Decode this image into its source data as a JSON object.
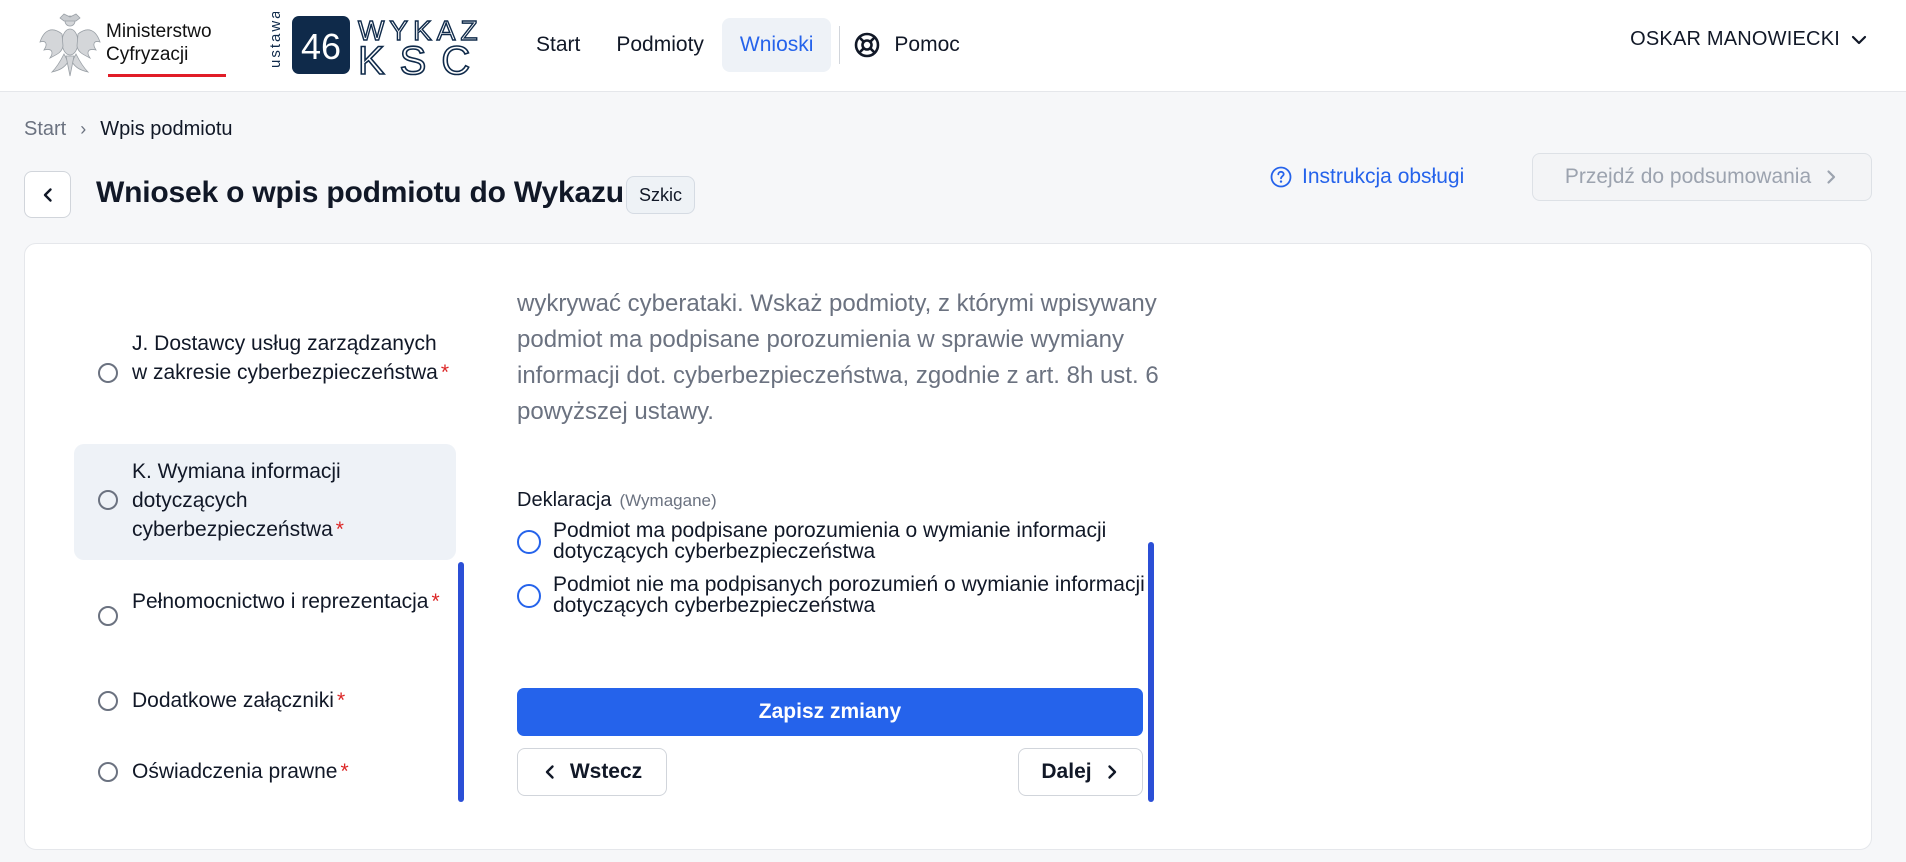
{
  "header": {
    "ministry_name_line1": "Ministerstwo",
    "ministry_name_line2": "Cyfryzacji",
    "ksc_logo_number": "46",
    "ksc_logo_line1": "WYKAZ",
    "ksc_logo_line2": "KSC",
    "ksc_logo_vertical": "ustawa",
    "nav": {
      "start": "Start",
      "entities": "Podmioty",
      "applications": "Wnioski",
      "help": "Pomoc"
    },
    "active_nav": "Wnioski",
    "user_name": "OSKAR MANOWIECKI"
  },
  "breadcrumb": {
    "start": "Start",
    "separator": "›",
    "current": "Wpis podmiotu"
  },
  "page": {
    "title": "Wniosek o wpis podmiotu do Wykazu",
    "status": "Szkic",
    "instructions_link": "Instrukcja obsługi",
    "summary_button": "Przejdź do podsumowania"
  },
  "steps": [
    {
      "label": "J. Dostawcy usług zarządzanych w zakresie cyberbezpieczeństwa",
      "required_mark": "*"
    },
    {
      "label": "K. Wymiana informacji dotyczących cyberbezpieczeństwa",
      "required_mark": "*"
    },
    {
      "label": "Pełnomocnictwo i reprezentacja",
      "required_mark": "*"
    },
    {
      "label": "Dodatkowe załączniki",
      "required_mark": "*"
    },
    {
      "label": "Oświadczenia prawne",
      "required_mark": "*"
    }
  ],
  "active_step": "K. Wymiana informacji dotyczących cyberbezpieczeństwa",
  "content": {
    "intro_text": "wykrywać cyberataki. Wskaż podmioty, z którymi wpisywany podmiot ma podpisane porozumienia w sprawie wymiany informacji dot. cyberbezpieczeństwa, zgodnie z art. 8h ust. 6 powyższej ustawy.",
    "declaration_label": "Deklaracja",
    "declaration_required": "(Wymagane)",
    "options": [
      "Podmiot ma podpisane porozumienia o wymianie informacji dotyczących cyberbezpieczeństwa",
      "Podmiot nie ma podpisanych porozumień o wymianie informacji dotyczących cyberbezpieczeństwa"
    ],
    "save_button": "Zapisz zmiany",
    "back_button": "Wstecz",
    "next_button": "Dalej"
  },
  "colors": {
    "accent": "#2563eb",
    "required": "#dc2626",
    "scrollbar": "#2b4fd6",
    "logo_dark": "#0f2a4a"
  }
}
